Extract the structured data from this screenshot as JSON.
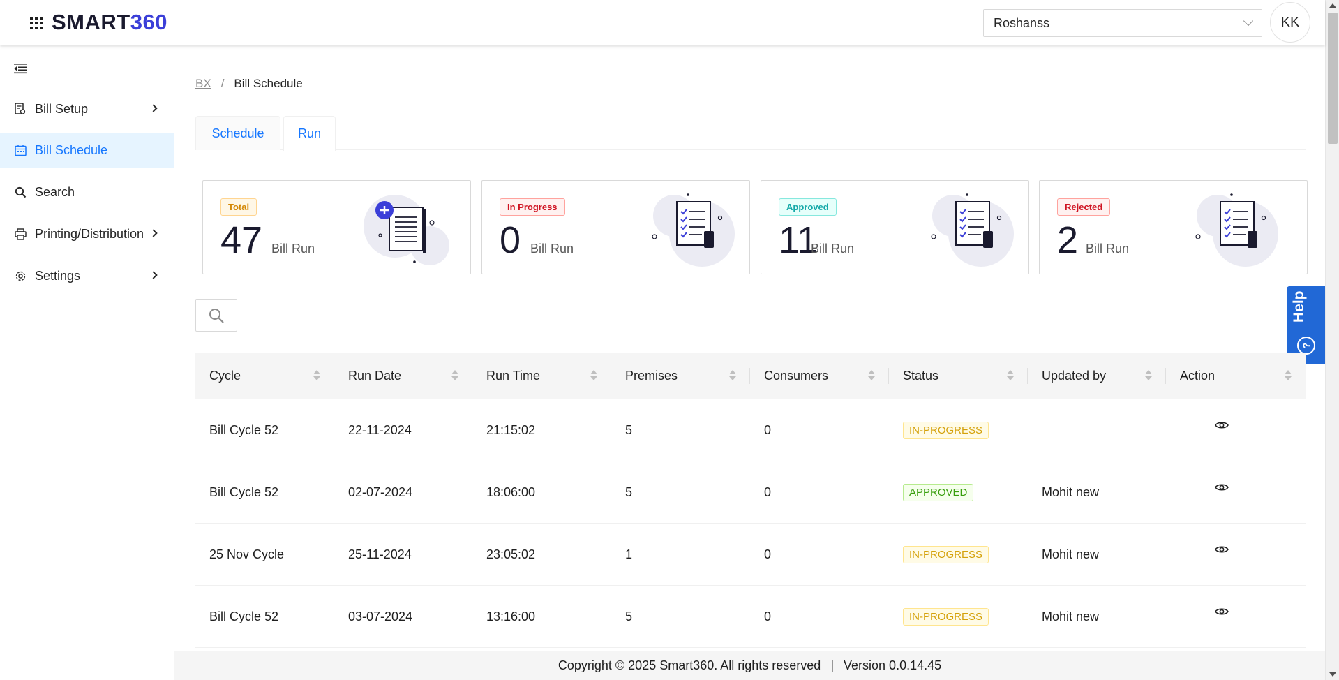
{
  "header": {
    "logo_part1": "SMART",
    "logo_part2": "360",
    "org_value": "Roshanss",
    "avatar_initials": "KK"
  },
  "sidebar": {
    "items": [
      {
        "label": "Bill Setup",
        "icon": "bill-setup-icon",
        "has_arrow": true
      },
      {
        "label": "Bill Schedule",
        "icon": "calendar-icon",
        "active": true
      },
      {
        "label": "Search",
        "icon": "search-icon"
      },
      {
        "label": "Printing/Distribution",
        "icon": "printer-icon",
        "has_arrow": true
      },
      {
        "label": "Settings",
        "icon": "gear-icon",
        "has_arrow": true
      }
    ]
  },
  "breadcrumb": {
    "root": "BX",
    "separator": "/",
    "current": "Bill Schedule"
  },
  "tabs": [
    {
      "label": "Schedule"
    },
    {
      "label": "Run",
      "active": true
    }
  ],
  "cards": [
    {
      "badge": "Total",
      "value": "47",
      "unit": "Bill Run",
      "badge_color": "#d48806",
      "badge_bg": "#fff7e6",
      "badge_border": "#ffd591"
    },
    {
      "badge": "In Progress",
      "value": "0",
      "unit": "Bill Run",
      "badge_color": "#cf1322",
      "badge_bg": "#fff1f0",
      "badge_border": "#ffa39e"
    },
    {
      "badge": "Approved",
      "value": "11",
      "unit": "Bill Run",
      "badge_color": "#13a8a8",
      "badge_bg": "#e6fffb",
      "badge_border": "#87e8de"
    },
    {
      "badge": "Rejected",
      "value": "2",
      "unit": "Bill Run",
      "badge_color": "#cf1322",
      "badge_bg": "#fff1f0",
      "badge_border": "#ffa39e"
    }
  ],
  "help": {
    "label": "Help",
    "glyph": "?"
  },
  "table": {
    "columns": [
      "Cycle",
      "Run Date",
      "Run Time",
      "Premises",
      "Consumers",
      "Status",
      "Updated by",
      "Action"
    ],
    "rows": [
      {
        "cycle": "Bill Cycle 52",
        "run_date": "22-11-2024",
        "run_time": "21:15:02",
        "premises": "5",
        "consumers": "0",
        "status": "IN-PROGRESS",
        "status_type": "inprog",
        "updated_by": ""
      },
      {
        "cycle": "Bill Cycle 52",
        "run_date": "02-07-2024",
        "run_time": "18:06:00",
        "premises": "5",
        "consumers": "0",
        "status": "APPROVED",
        "status_type": "approved",
        "updated_by": "Mohit new"
      },
      {
        "cycle": "25 Nov Cycle",
        "run_date": "25-11-2024",
        "run_time": "23:05:02",
        "premises": "1",
        "consumers": "0",
        "status": "IN-PROGRESS",
        "status_type": "inprog",
        "updated_by": "Mohit new"
      },
      {
        "cycle": "Bill Cycle 52",
        "run_date": "03-07-2024",
        "run_time": "13:16:00",
        "premises": "5",
        "consumers": "0",
        "status": "IN-PROGRESS",
        "status_type": "inprog",
        "updated_by": "Mohit new"
      }
    ]
  },
  "footer": {
    "copyright": "Copyright © 2025 Smart360. All rights reserved",
    "separator": "|",
    "version": "Version 0.0.14.45"
  }
}
